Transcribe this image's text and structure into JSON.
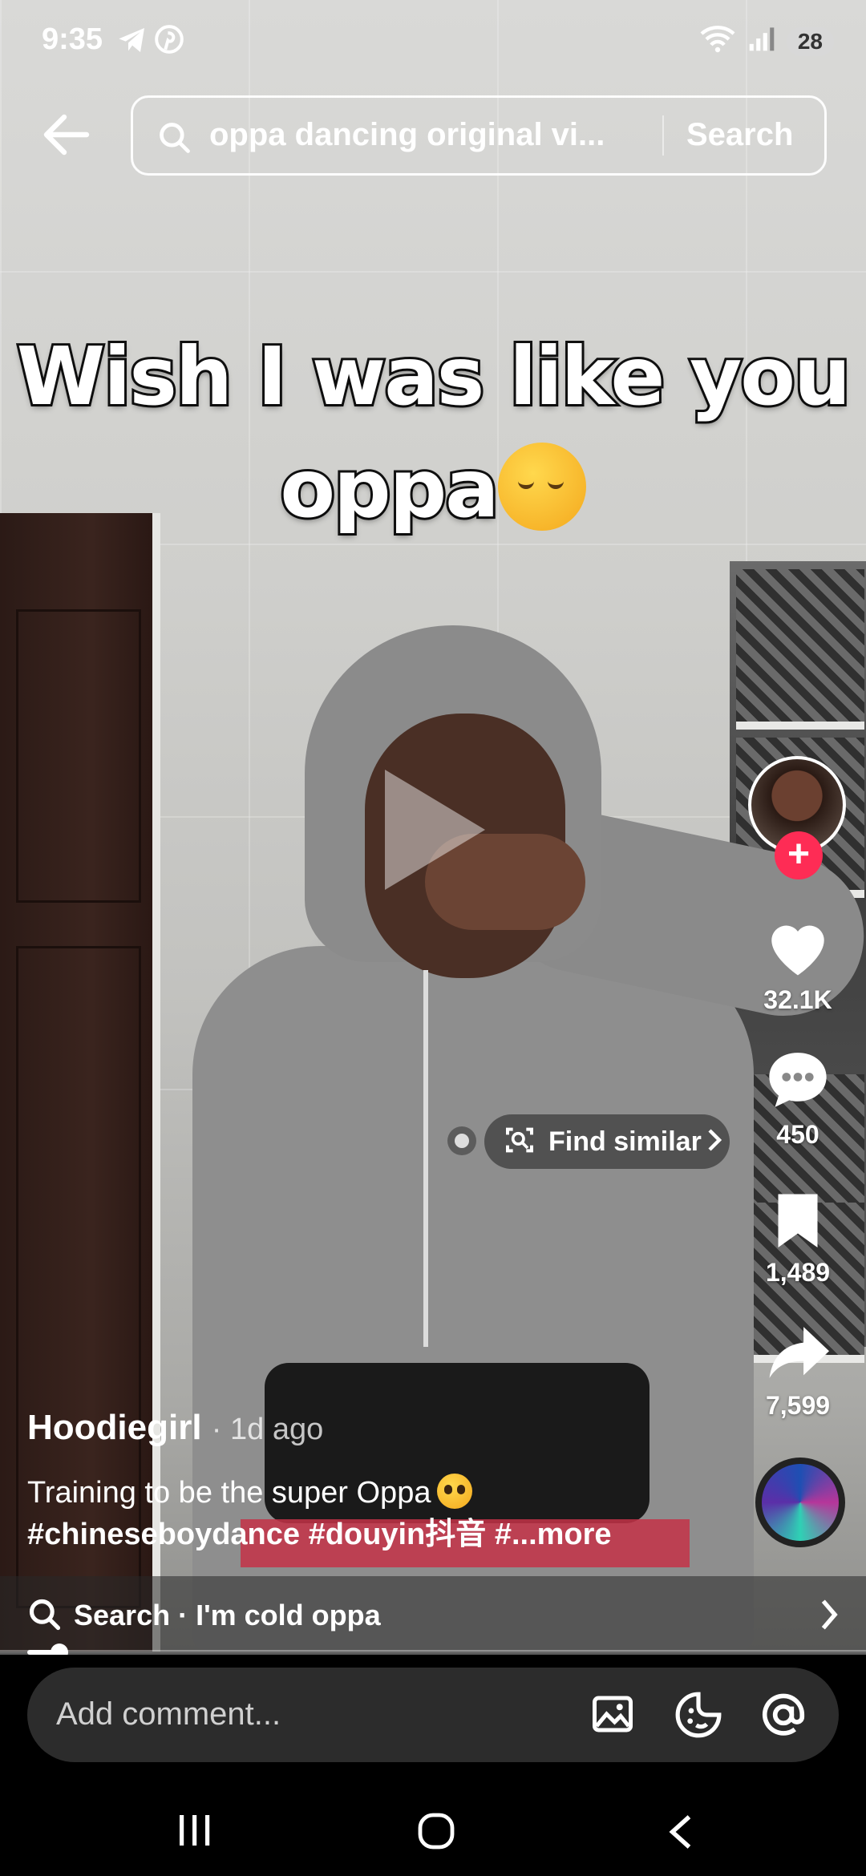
{
  "status": {
    "time": "9:35",
    "battery": "28",
    "left_icons": [
      "telegram-icon",
      "pinterest-icon"
    ],
    "right_icons": [
      "wifi-icon",
      "signal-icon"
    ]
  },
  "search": {
    "query": "oppa dancing original vi...",
    "button_label": "Search"
  },
  "video": {
    "caption_line1": "Wish I was like you",
    "caption_line2": "oppa"
  },
  "rail": {
    "likes": "32.1K",
    "comments": "450",
    "saves": "1,489",
    "shares": "7,599"
  },
  "find_similar": "Find similar",
  "post": {
    "author": "Hoodiegirl",
    "time_ago": "· 1d ago",
    "description": "Training to be the super Oppa",
    "hashtags": "#chineseboydance #douyin抖音 #...more"
  },
  "search_suggestion": "Search · I'm cold oppa",
  "progress": 0.04,
  "comment_placeholder": "Add comment...",
  "colors": {
    "follow_accent": "#fe2c55",
    "comment_bg": "#2c2c2c"
  }
}
